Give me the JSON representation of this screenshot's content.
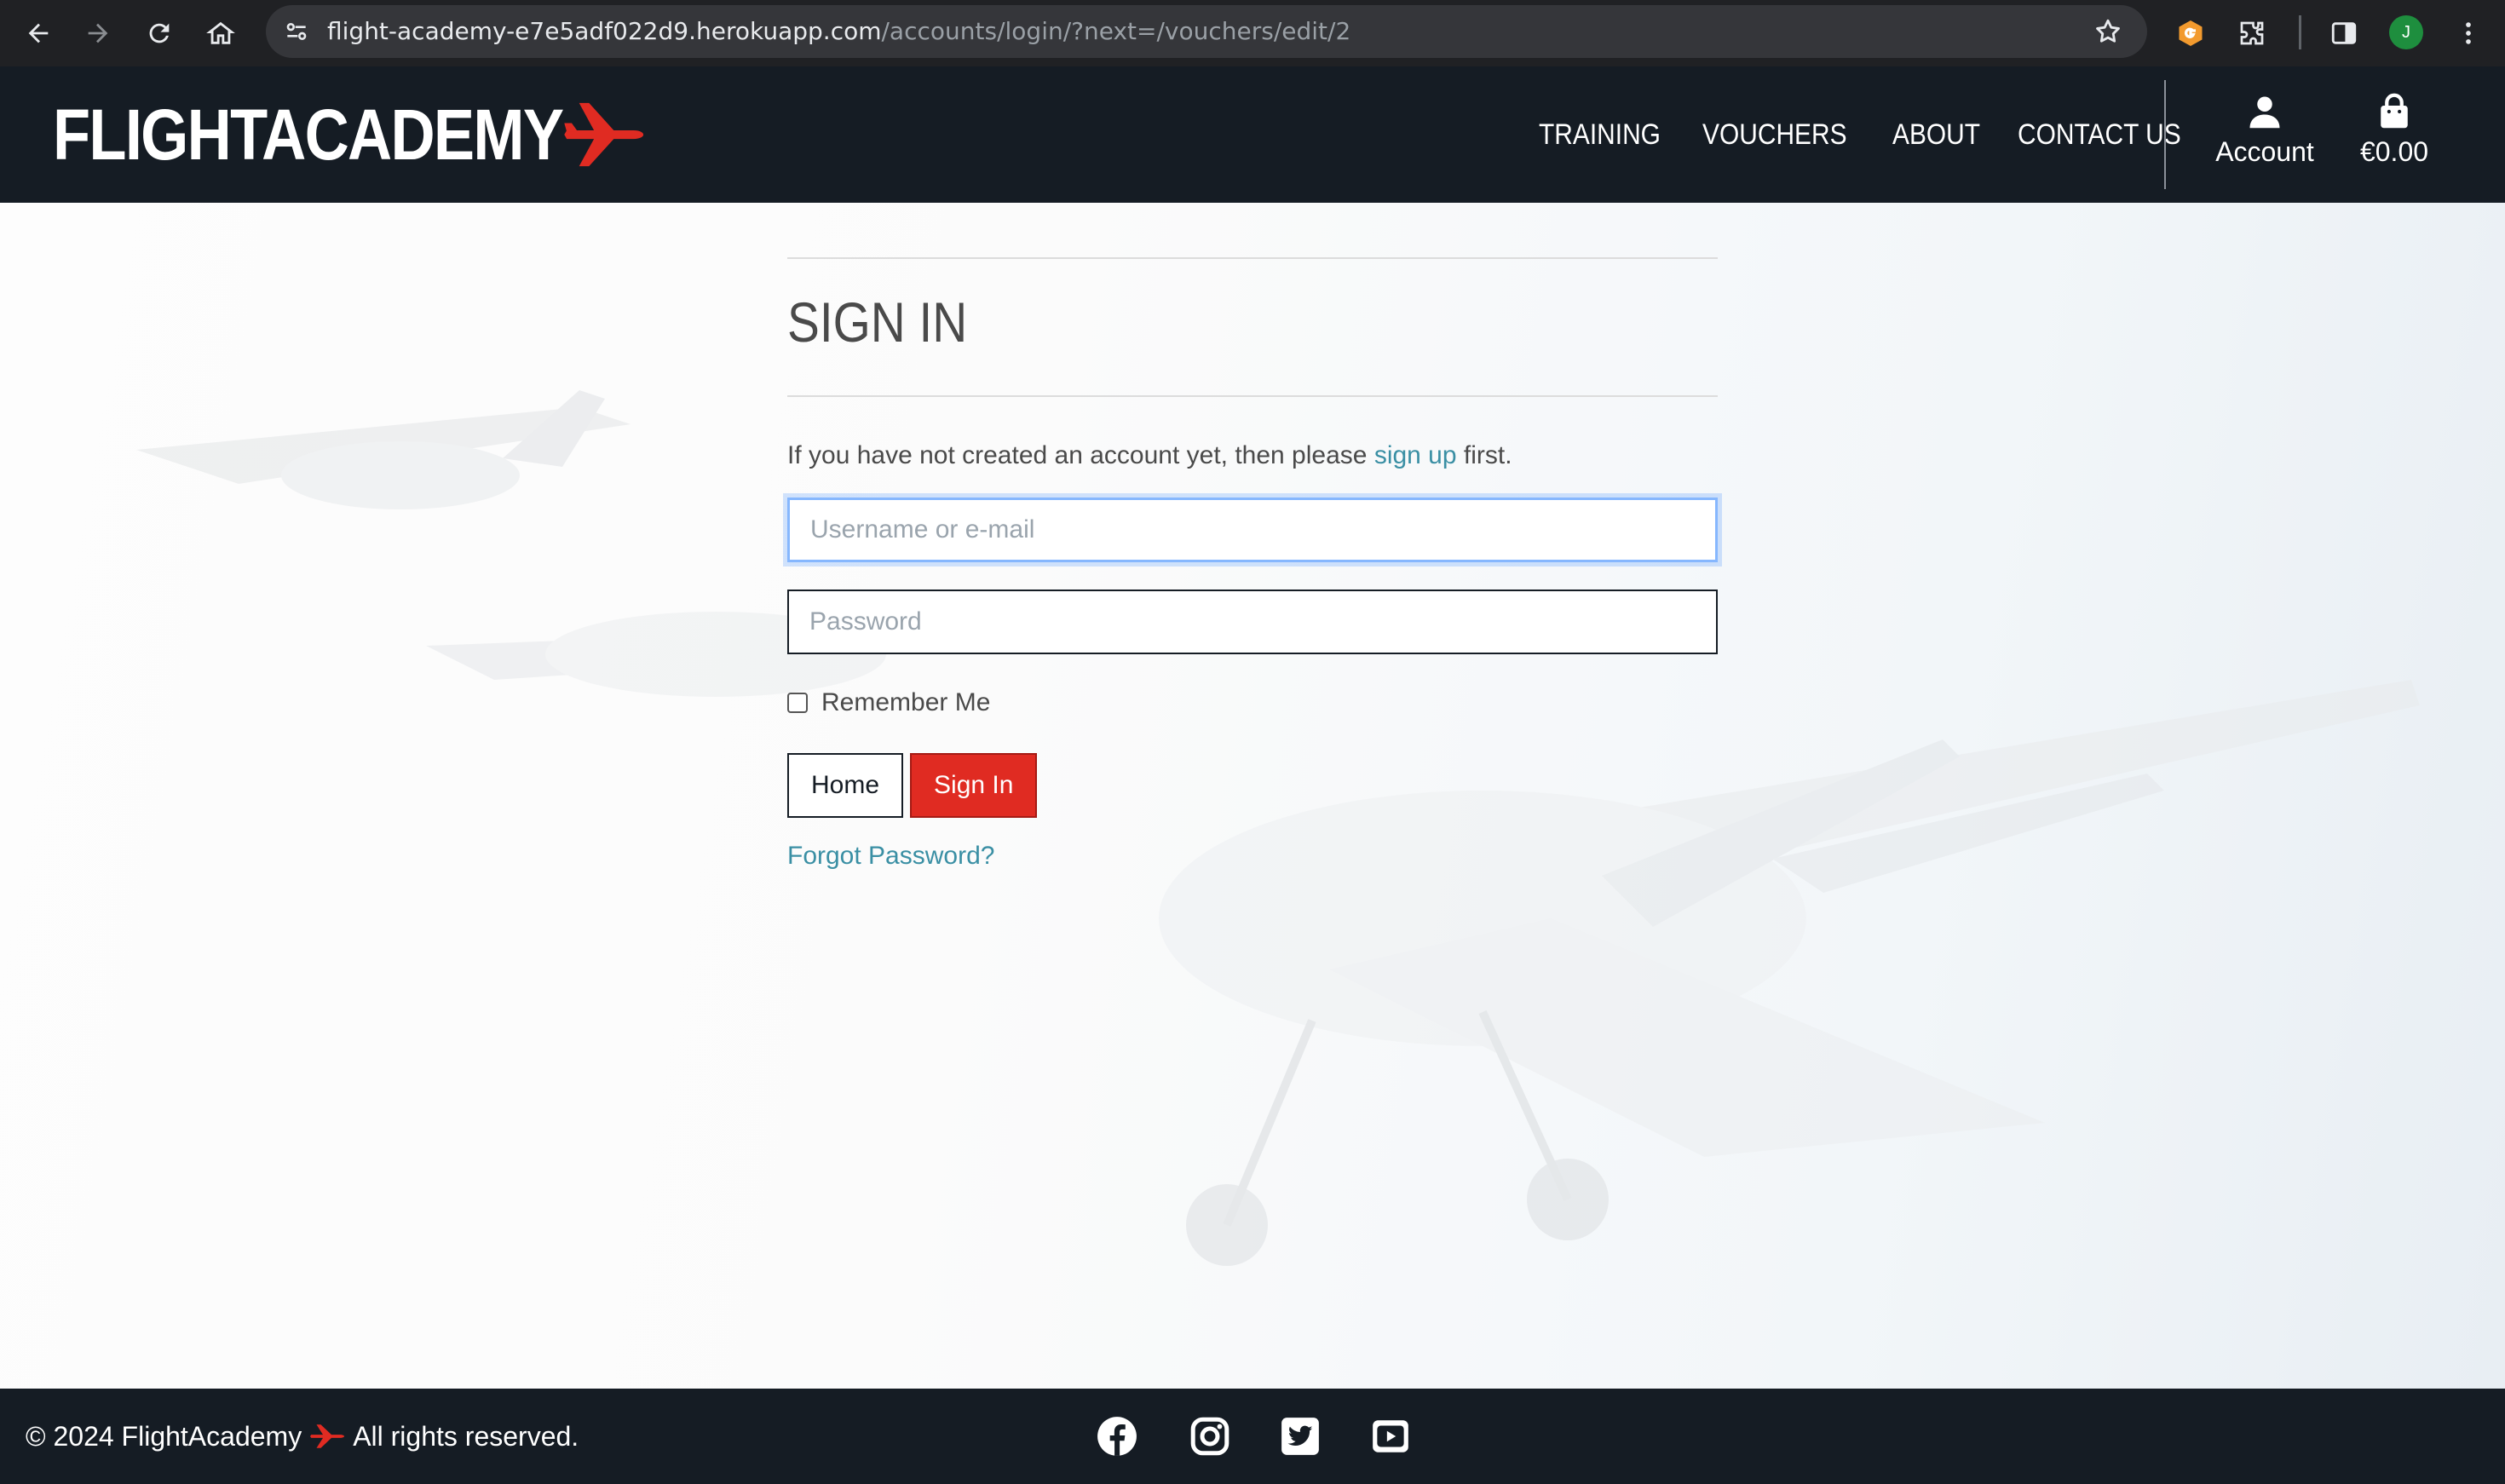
{
  "browser": {
    "url_host": "flight-academy-e7e5adf022d9.herokuapp.com",
    "url_path": "/accounts/login/?next=/vouchers/edit/2",
    "profile_initial": "J"
  },
  "header": {
    "logo_text": "FLIGHTACADEMY",
    "nav": [
      "TRAINING",
      "VOUCHERS",
      "ABOUT",
      "CONTACT US"
    ],
    "account_label": "Account",
    "cart_total": "€0.00"
  },
  "signin": {
    "title": "SIGN IN",
    "intro_before": "If you have not created an account yet, then please ",
    "signup_link": "sign up",
    "intro_after": " first.",
    "username_placeholder": "Username or e-mail",
    "password_placeholder": "Password",
    "remember_label": "Remember Me",
    "home_button": "Home",
    "signin_button": "Sign In",
    "forgot_link": "Forgot Password?"
  },
  "footer": {
    "copyright_before": "© 2024 FlightAcademy",
    "copyright_after": "All rights reserved.",
    "social": [
      "facebook-icon",
      "instagram-icon",
      "twitter-icon",
      "youtube-icon"
    ]
  },
  "colors": {
    "header_bg": "#151c24",
    "accent_red": "#e02b22",
    "link_teal": "#3a8fa4"
  }
}
